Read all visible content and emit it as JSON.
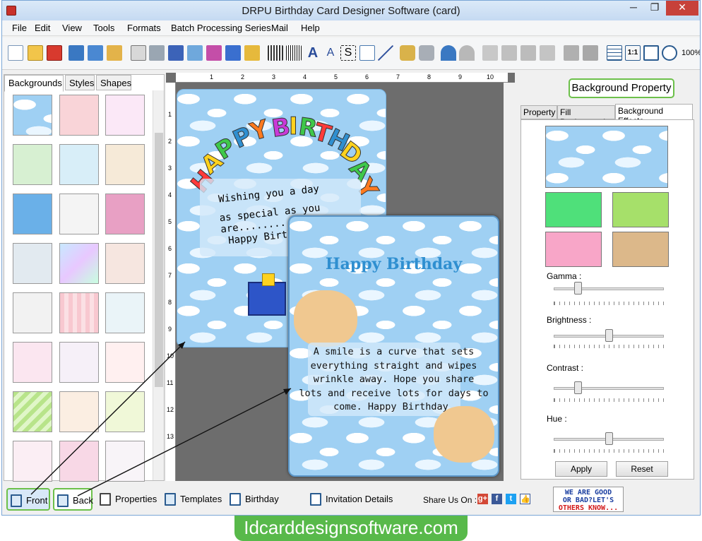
{
  "window": {
    "title": "DRPU Birthday Card Designer Software (card)",
    "min": "─",
    "max": "❐",
    "close": "✕"
  },
  "menu": [
    "File",
    "Edit",
    "View",
    "Tools",
    "Formats",
    "Batch Processing Series",
    "Mail",
    "Help"
  ],
  "toolbar": {
    "zoom": "100%"
  },
  "left_tabs": [
    {
      "label": "Backgrounds",
      "active": true
    },
    {
      "label": "Styles",
      "active": false
    },
    {
      "label": "Shapes",
      "active": false
    }
  ],
  "ruler": {
    "h": [
      "1",
      "2",
      "3",
      "4",
      "5",
      "6",
      "7",
      "8",
      "9",
      "10"
    ],
    "v": [
      "1",
      "2",
      "3",
      "4",
      "5",
      "6",
      "7",
      "8",
      "9",
      "10",
      "11",
      "12",
      "13"
    ]
  },
  "front_card": {
    "heading_letters": [
      "H",
      "A",
      "P",
      "P",
      "Y",
      "B",
      "I",
      "R",
      "T",
      "H",
      "D",
      "A",
      "Y"
    ],
    "line1": "Wishing you a day",
    "line2": "as special as you are........",
    "line3": "Happy Birthday"
  },
  "back_card": {
    "heading": "Happy Birthday",
    "message": [
      "A smile is a curve that sets",
      "everything straight and wipes",
      "wrinkle away. Hope you share",
      "lots and receive lots for days to",
      "come. Happy Birthday."
    ]
  },
  "right_panel": {
    "title": "Background Property",
    "tabs": [
      {
        "label": "Property",
        "active": false
      },
      {
        "label": "Fill Background",
        "active": false
      },
      {
        "label": "Background Effects",
        "active": true
      }
    ],
    "sliders": [
      {
        "label": "Gamma :",
        "value": 0.22
      },
      {
        "label": "Brightness :",
        "value": 0.5
      },
      {
        "label": "Contrast :",
        "value": 0.22
      },
      {
        "label": "Hue :",
        "value": 0.5
      }
    ],
    "apply": "Apply",
    "reset": "Reset"
  },
  "bottom": {
    "front": "Front",
    "back": "Back",
    "properties": "Properties",
    "templates": "Templates",
    "birthday_details": "Birthday Details",
    "invitation_details": "Invitation Details",
    "share": "Share Us On :",
    "badge": [
      "WE ARE GOOD",
      "OR BAD?LET'S",
      "OTHERS KNOW..."
    ]
  },
  "site": "Idcarddesignsoftware.com",
  "colors": {
    "accent_green": "#6cc04a",
    "sky": "#9fd0f3",
    "heading_blue": "#2f8fd0"
  }
}
